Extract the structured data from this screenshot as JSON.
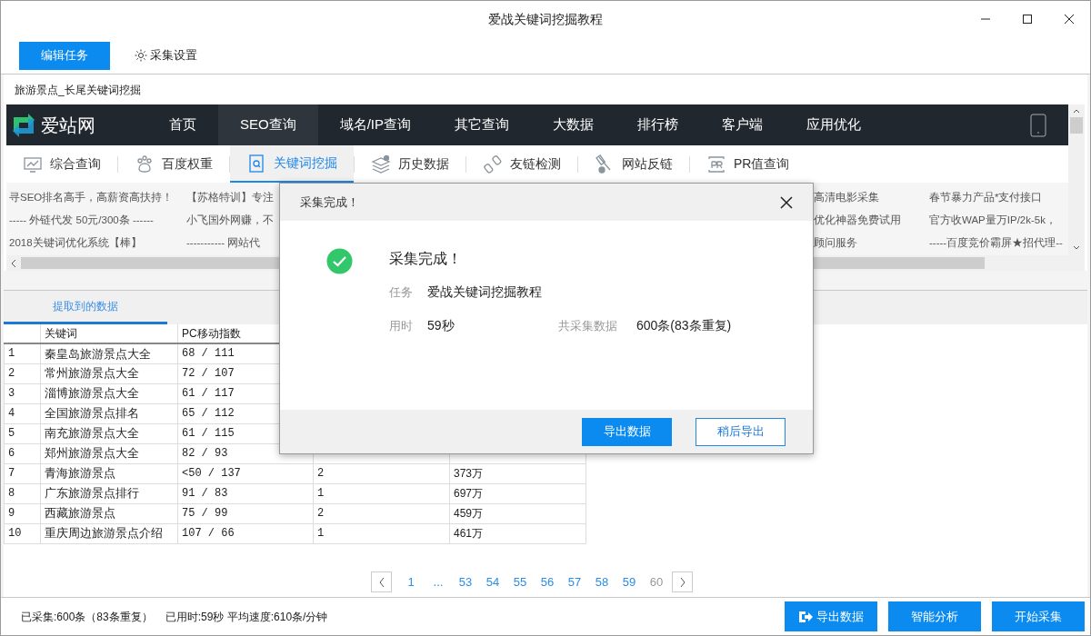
{
  "window": {
    "title": "爱战关键词挖掘教程"
  },
  "toolbar": {
    "edit_button": "编辑任务",
    "settings_link": "采集设置"
  },
  "task_label": "旅游景点_长尾关键词挖掘",
  "webview": {
    "logo": "爱站网",
    "nav": [
      {
        "label": "首页",
        "selected": false
      },
      {
        "label": "SEO查询",
        "selected": true
      },
      {
        "label": "域名/IP查询",
        "selected": false
      },
      {
        "label": "其它查询",
        "selected": false
      },
      {
        "label": "大数据",
        "selected": false
      },
      {
        "label": "排行榜",
        "selected": false
      },
      {
        "label": "客户端",
        "selected": false
      },
      {
        "label": "应用优化",
        "selected": false
      }
    ],
    "subtabs": [
      {
        "label": "综合查询",
        "kind": "monitor",
        "selected": false
      },
      {
        "label": "百度权重",
        "kind": "paw",
        "selected": false
      },
      {
        "label": "关键词挖掘",
        "kind": "search",
        "selected": true
      },
      {
        "label": "历史数据",
        "kind": "stack",
        "selected": false
      },
      {
        "label": "友链检测",
        "kind": "link",
        "selected": false
      },
      {
        "label": "网站反链",
        "kind": "backlink",
        "selected": false
      },
      {
        "label": "PR值查询",
        "kind": "pr",
        "selected": false
      }
    ],
    "ads": [
      [
        "寻SEO排名高手，高薪资高扶持！",
        "----- 外链代发 50元/300条 ------",
        "2018关键词优化系统【棒】"
      ],
      [
        "【苏格特训】专注",
        "小飞国外网赚，不",
        "----------- 网站代"
      ],
      [
        "高清电影采集",
        "优化神器免费试用",
        "顾问服务"
      ],
      [
        "春节暴力产品*支付接口",
        "官方收WAP量万IP/2k-5k，",
        "-----百度竞价霸屏★招代理--"
      ]
    ]
  },
  "results_tab": {
    "label": "提取到的数据",
    "selected": true
  },
  "table": {
    "columns": [
      "关键词",
      "PC移动指数"
    ],
    "rows": [
      {
        "index": "1",
        "keyword": "秦皇岛旅游景点大全",
        "pc_mobile": "68 / 111"
      },
      {
        "index": "2",
        "keyword": "常州旅游景点大全",
        "pc_mobile": "72 / 107"
      },
      {
        "index": "3",
        "keyword": "淄博旅游景点大全",
        "pc_mobile": "61 / 117"
      },
      {
        "index": "4",
        "keyword": "全国旅游景点排名",
        "pc_mobile": "65 / 112"
      },
      {
        "index": "5",
        "keyword": "南充旅游景点大全",
        "pc_mobile": "61 / 115"
      },
      {
        "index": "6",
        "keyword": "郑州旅游景点大全",
        "pc_mobile": "82 / 93"
      },
      {
        "index": "7",
        "keyword": "青海旅游景点",
        "pc_mobile": "<50 / 137",
        "column_4": "2",
        "column_5": "373万"
      },
      {
        "index": "8",
        "keyword": "广东旅游景点排行",
        "pc_mobile": "91 / 83",
        "column_4": "1",
        "column_5": "697万"
      },
      {
        "index": "9",
        "keyword": "西藏旅游景点",
        "pc_mobile": "75 / 99",
        "column_4": "2",
        "column_5": "459万"
      },
      {
        "index": "10",
        "keyword": "重庆周边旅游景点介绍",
        "pc_mobile": "107 / 66",
        "column_4": "1",
        "column_5": "461万"
      }
    ]
  },
  "pagination": {
    "pages": [
      {
        "label": "1",
        "selected": false
      },
      {
        "label": "...",
        "selected": false
      },
      {
        "label": "53",
        "selected": false
      },
      {
        "label": "54",
        "selected": false
      },
      {
        "label": "55",
        "selected": false
      },
      {
        "label": "56",
        "selected": false
      },
      {
        "label": "57",
        "selected": false
      },
      {
        "label": "58",
        "selected": false
      },
      {
        "label": "59",
        "selected": false
      },
      {
        "label": "60",
        "selected": true
      }
    ]
  },
  "status_bar": {
    "collected": "已采集:600条（83条重复）",
    "timing": "已用时:59秒 平均速度:610条/分钟",
    "buttons": [
      {
        "label": "导出数据",
        "kind": "export"
      },
      {
        "label": "智能分析",
        "kind": "plain"
      },
      {
        "label": "开始采集",
        "kind": "plain"
      }
    ]
  },
  "dialog": {
    "title": "采集完成！",
    "heading": "采集完成！",
    "fields": [
      {
        "label": "任务",
        "value": "爱战关键词挖掘教程"
      },
      {
        "label": "用时",
        "value": "59秒"
      },
      {
        "label": "共采集数据",
        "value": "600条(83条重复)"
      }
    ],
    "buttons": [
      {
        "label": "导出数据",
        "kind": "primary"
      },
      {
        "label": "稍后导出",
        "kind": "secondary"
      }
    ]
  }
}
